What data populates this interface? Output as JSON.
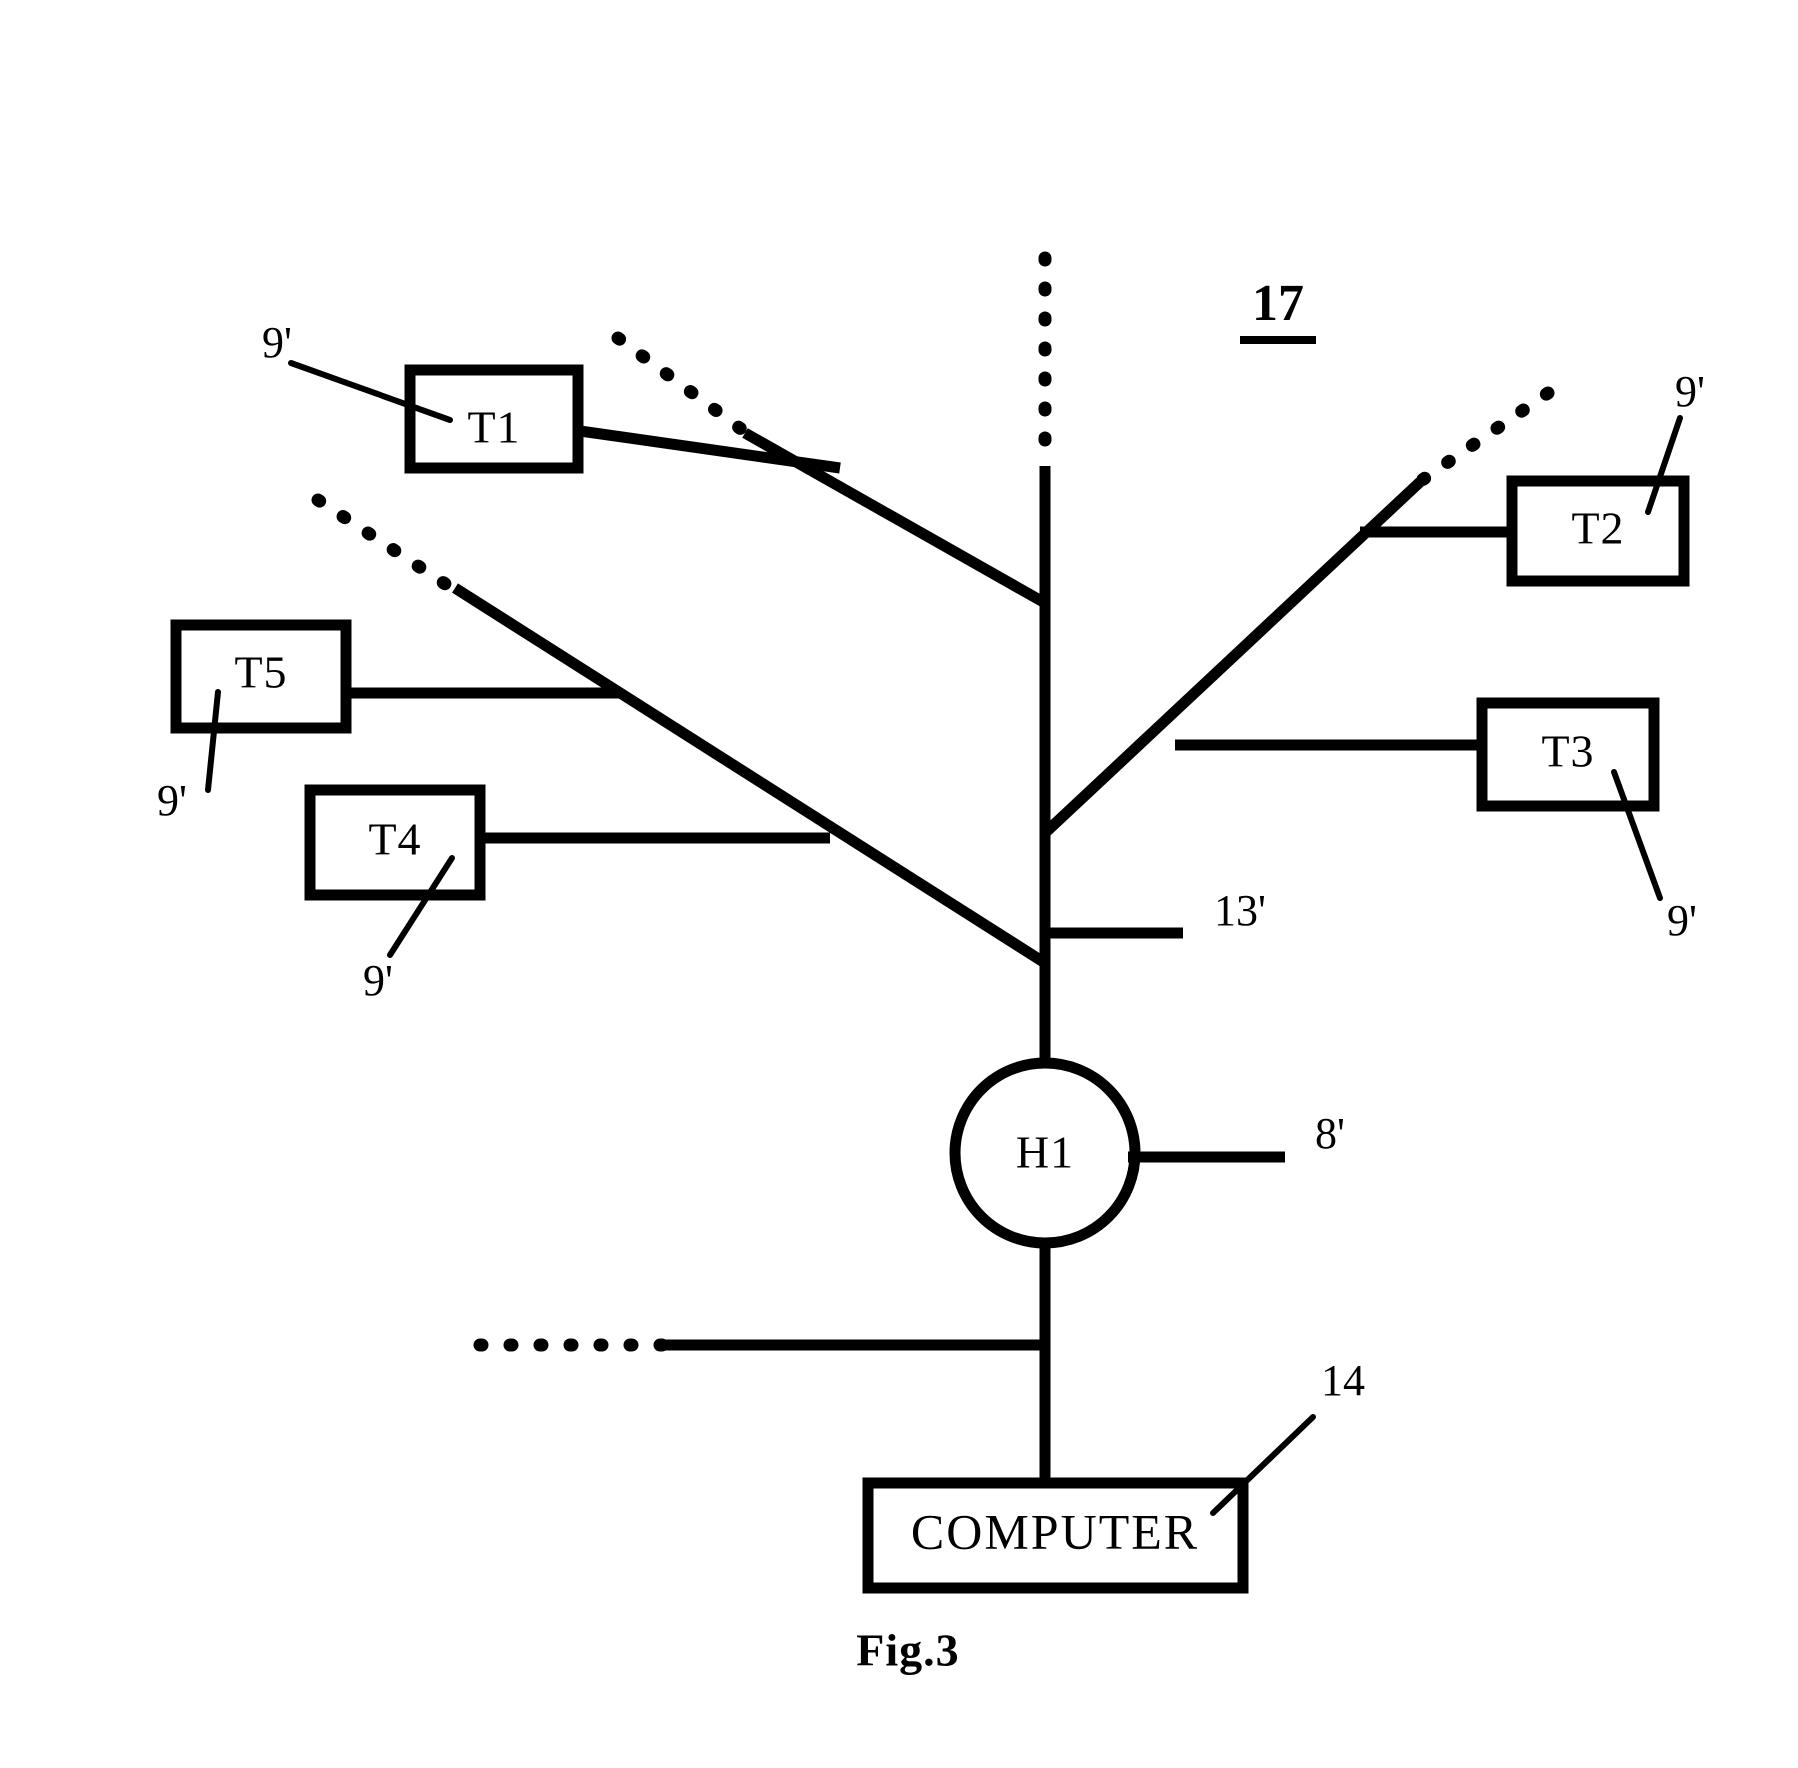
{
  "figure": {
    "caption": "Fig.3",
    "assembly_label": "17"
  },
  "nodes": {
    "terminals": [
      {
        "id": "T1",
        "label": "T1",
        "ref": "9'"
      },
      {
        "id": "T2",
        "label": "T2",
        "ref": "9'"
      },
      {
        "id": "T3",
        "label": "T3",
        "ref": "9'"
      },
      {
        "id": "T4",
        "label": "T4",
        "ref": "9'"
      },
      {
        "id": "T5",
        "label": "T5",
        "ref": "9'"
      }
    ],
    "hub": {
      "label": "H1",
      "ref": "8'"
    },
    "computer": {
      "label": "COMPUTER",
      "ref": "14"
    },
    "bus": {
      "ref": "13'"
    }
  },
  "reference_numerals": {
    "terminal_ref": "9'",
    "hub_ref": "8'",
    "bus_ref": "13'",
    "computer_ref": "14",
    "assembly_ref": "17"
  },
  "colors": {
    "ink": "#000000",
    "paper": "#ffffff"
  }
}
